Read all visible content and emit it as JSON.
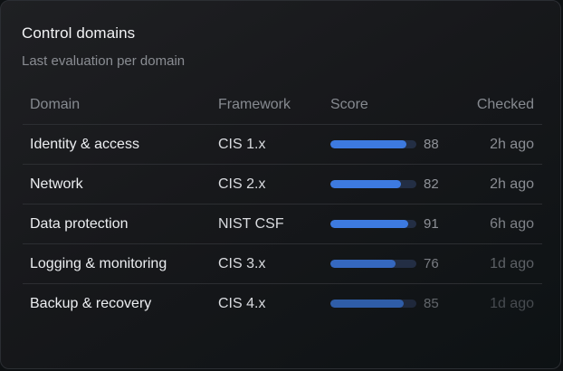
{
  "card": {
    "title": "Control domains",
    "subtitle": "Last evaluation per domain"
  },
  "table": {
    "columns": {
      "domain": "Domain",
      "framework": "Framework",
      "score": "Score",
      "checked": "Checked"
    },
    "rows": [
      {
        "domain": "Identity & access",
        "framework": "CIS 1.x",
        "score": "88",
        "checked": "2h ago"
      },
      {
        "domain": "Network",
        "framework": "CIS 2.x",
        "score": "82",
        "checked": "2h ago"
      },
      {
        "domain": "Data protection",
        "framework": "NIST CSF",
        "score": "91",
        "checked": "6h ago"
      },
      {
        "domain": "Logging & monitoring",
        "framework": "CIS 3.x",
        "score": "76",
        "checked": "1d ago"
      },
      {
        "domain": "Backup & recovery",
        "framework": "CIS 4.x",
        "score": "85",
        "checked": "1d ago"
      }
    ]
  },
  "colors": {
    "accent": "#3d7ae0",
    "track": "#232e44",
    "background": "#1b1c1f",
    "text": "#eceef1",
    "muted": "#8a8d93"
  }
}
